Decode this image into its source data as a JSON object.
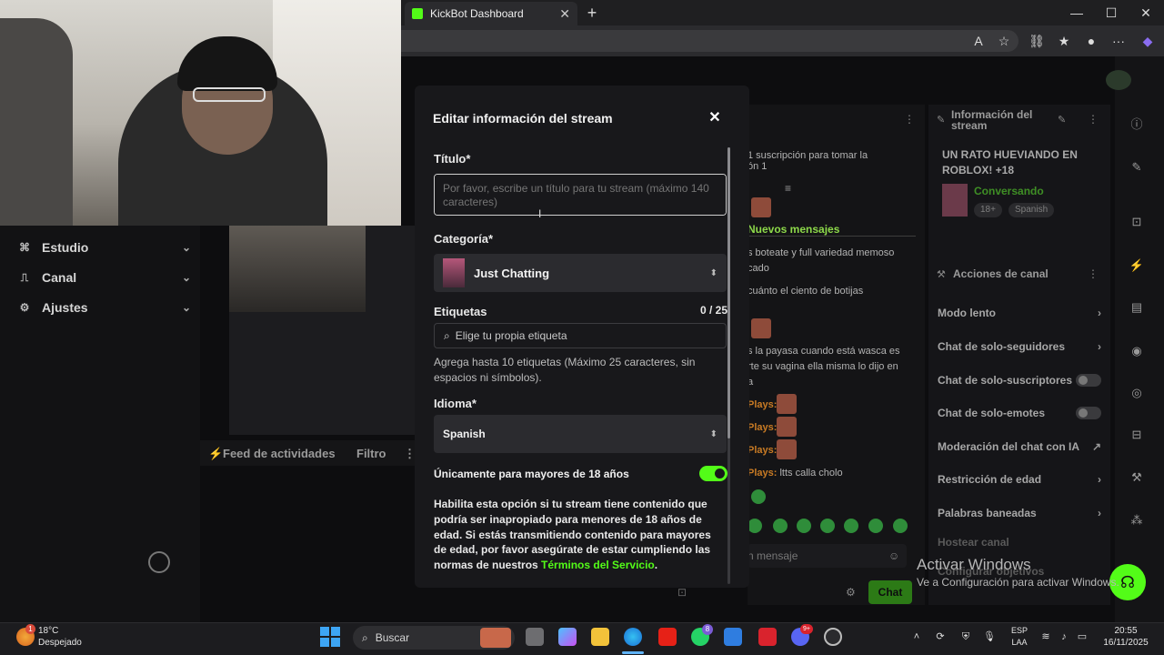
{
  "browser": {
    "tab_title": "KickBot Dashboard",
    "tab_close": "✕",
    "new_tab": "+",
    "window": {
      "minimize": "—",
      "maximize": "☐",
      "close": "✕"
    },
    "toolbar": {
      "read_aloud": "A",
      "favorite": "☆",
      "extensions": "⛓",
      "favorites": "★",
      "profile": "●",
      "more": "···",
      "copilot": "◆"
    }
  },
  "sidebar": {
    "items": [
      {
        "label": "Estudio",
        "icon": "⌘"
      },
      {
        "label": "Canal",
        "icon": "⎍"
      },
      {
        "label": "Ajustes",
        "icon": "⚙"
      }
    ],
    "chevron": "⌄"
  },
  "feed": {
    "label": "Feed de actividades",
    "filter": "Filtro",
    "more": "⋮",
    "icon": "⚡"
  },
  "chat": {
    "sub_note": "1 suscripción para tomar la",
    "sub_note2": "ón 1",
    "new_messages": "Nuevos mensajes",
    "lines": [
      "s boteate y full variedad memoso",
      "cado",
      "cuánto el ciento de botijas",
      "s la payasa cuando está wasca es",
      "rte su vagina ella misma lo dijo en",
      "a"
    ],
    "plays_prefix": "Plays:",
    "last_msg_text": "ltts calla cholo",
    "input_placeholder": "n mensaje",
    "send_label": "Chat"
  },
  "stream_info": {
    "header": "Información del stream",
    "title": "UN RATO HUEVIANDO EN ROBLOX! +18",
    "category": "Conversando",
    "tags": [
      "18+",
      "Spanish"
    ]
  },
  "channel_actions": {
    "header": "Acciones de canal",
    "items": [
      {
        "label": "Modo lento",
        "kind": "chevron"
      },
      {
        "label": "Chat de solo-seguidores",
        "kind": "chevron"
      },
      {
        "label": "Chat de solo-suscriptores",
        "kind": "toggle"
      },
      {
        "label": "Chat de solo-emotes",
        "kind": "toggle"
      },
      {
        "label": "Moderación del chat con IA",
        "kind": "external"
      },
      {
        "label": "Restricción de edad",
        "kind": "chevron"
      },
      {
        "label": "Palabras baneadas",
        "kind": "chevron"
      },
      {
        "label": "Hostear canal",
        "kind": "none"
      },
      {
        "label": "Configurar objetivos",
        "kind": "chevron"
      }
    ]
  },
  "activate_windows": {
    "title": "Activar Windows",
    "subtitle": "Ve a Configuración para activar Windows."
  },
  "modal": {
    "title": "Editar información del stream",
    "close": "✕",
    "title_label": "Título*",
    "title_placeholder": "Por favor, escribe un título para tu stream (máximo 140 caracteres)",
    "category_label": "Categoría*",
    "category_value": "Just Chatting",
    "tags_label": "Etiquetas",
    "tags_count": "0 / 25",
    "tags_placeholder": "Elige tu propia etiqueta",
    "tags_hint": "Agrega hasta 10 etiquetas (Máximo 25 caracteres, sin espacios ni símbolos).",
    "language_label": "Idioma*",
    "language_value": "Spanish",
    "adult_label": "Únicamente para mayores de 18 años",
    "adult_enabled": true,
    "adult_desc": "Habilita esta opción si tu stream tiene contenido que podría ser inapropiado para menores de 18 años de edad. Si estás transmitiendo contenido para mayores de edad, por favor asegúrate de estar cumpliendo las normas de nuestros ",
    "terms_link": "Términos del Servicio",
    "terms_suffix": ".",
    "select_arrow": "⬍"
  },
  "taskbar": {
    "weather_temp": "18°C",
    "weather_cond": "Despejado",
    "weather_badge": "1",
    "search_label": "Buscar",
    "lang_top": "ESP",
    "lang_bottom": "LAA",
    "time": "20:55",
    "date": "16/11/2025",
    "whatsapp_badge": "8",
    "discord_badge": "9+"
  },
  "colors": {
    "kick_green": "#53fc18",
    "modal_bg": "#18181b",
    "dark_bg": "#0d0d0f"
  }
}
